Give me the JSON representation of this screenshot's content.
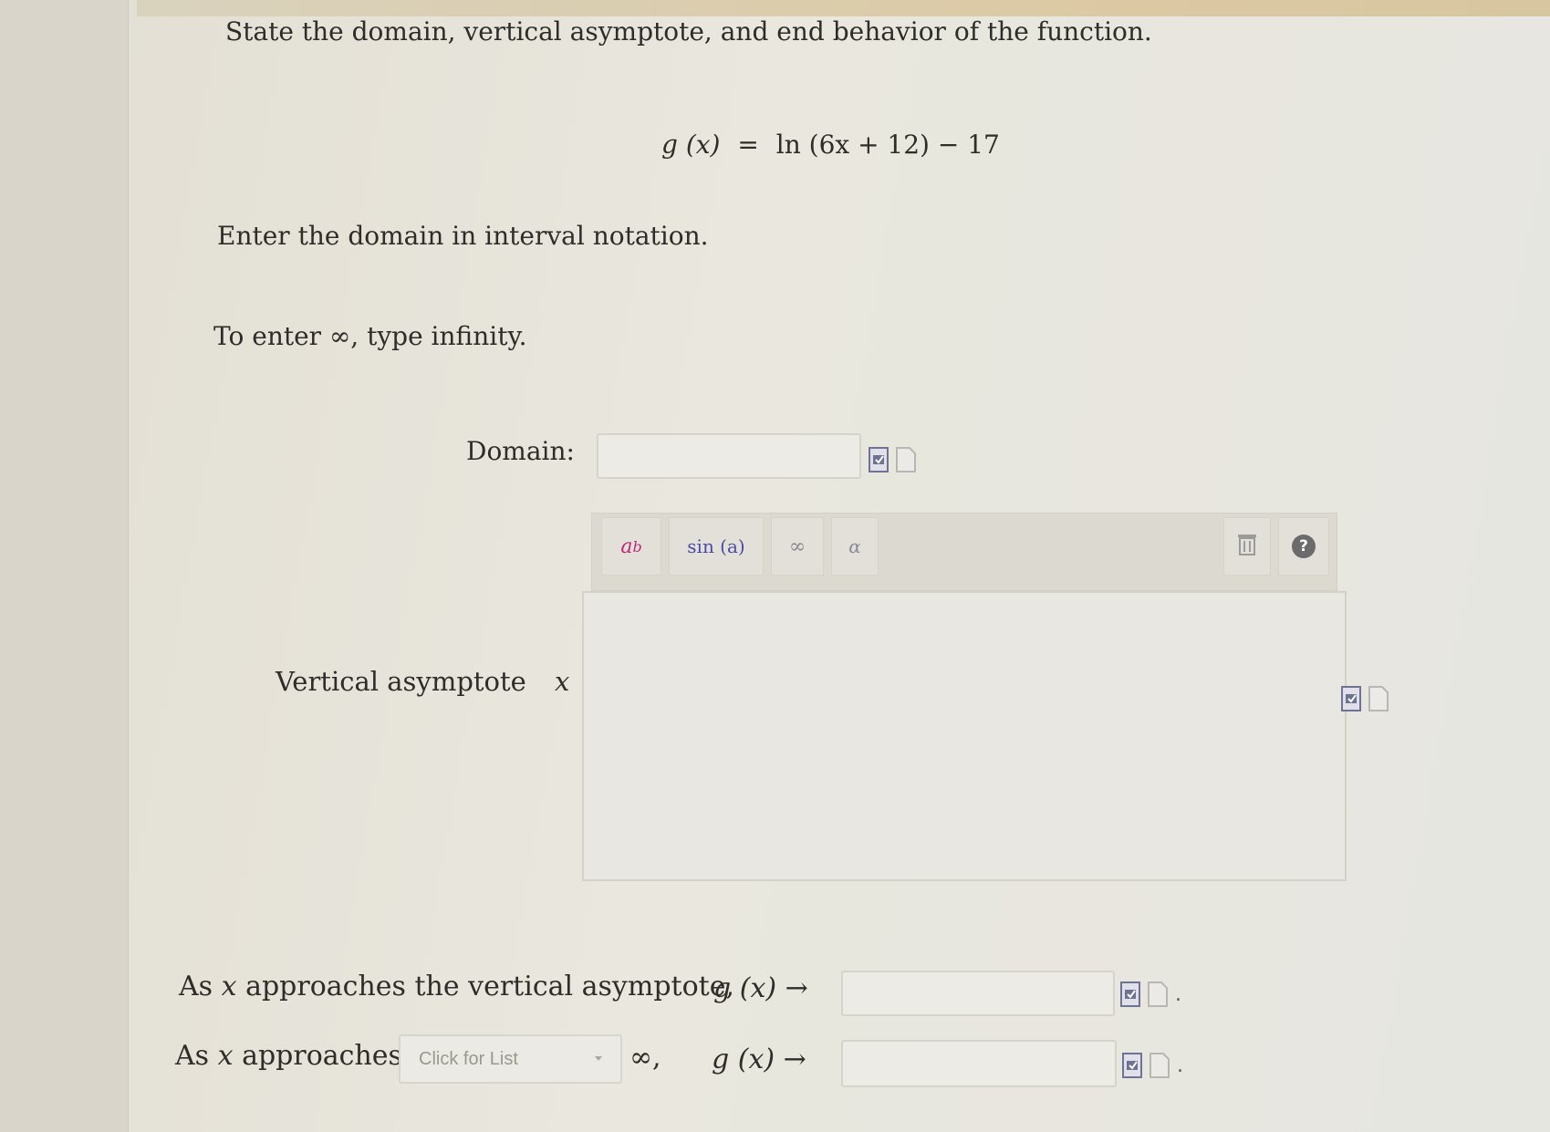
{
  "question": {
    "prompt": "State the domain, vertical asymptote, and end behavior of the function.",
    "function_lhs": "g (x)",
    "function_eq": "=",
    "function_rhs": "ln (6x + 12) − 17",
    "instruction_domain": "Enter the domain in interval notation.",
    "instruction_infinity": "To enter ∞, type infinity."
  },
  "domain_row": {
    "label": "Domain:",
    "value": ""
  },
  "math_toolbar": {
    "buttons": [
      {
        "label_base": "a",
        "label_sup": "b",
        "icon": "superscript-icon"
      },
      {
        "label": "sin (a)",
        "icon": "sin-function-icon"
      },
      {
        "label": "∞",
        "icon": "infinity-icon"
      },
      {
        "label": "α",
        "icon": "alpha-icon"
      }
    ],
    "trash_icon": "trash-icon",
    "help_icon": "help-icon",
    "help_glyph": "?"
  },
  "asymptote_row": {
    "label": "Vertical asymptote",
    "var": "x",
    "eq": "=",
    "value": ""
  },
  "end_behavior": {
    "row1_prefix": "As",
    "row1_var": "x",
    "row1_text": "approaches the vertical asymptote,",
    "row1_func": "g (x) →",
    "row1_value": "",
    "row2_prefix": "As",
    "row2_var": "x",
    "row2_text": "approaches",
    "select_placeholder": "Click for List",
    "row2_infinity": "∞,",
    "row2_func": "g (x) →",
    "row2_value": "",
    "trailing_period": "."
  },
  "colors": {
    "accent_superscript": "#c0287a",
    "accent_sin": "#4a4aa8",
    "icon_fill": "#7a7fa2",
    "help_bg": "#6b6b6b"
  }
}
